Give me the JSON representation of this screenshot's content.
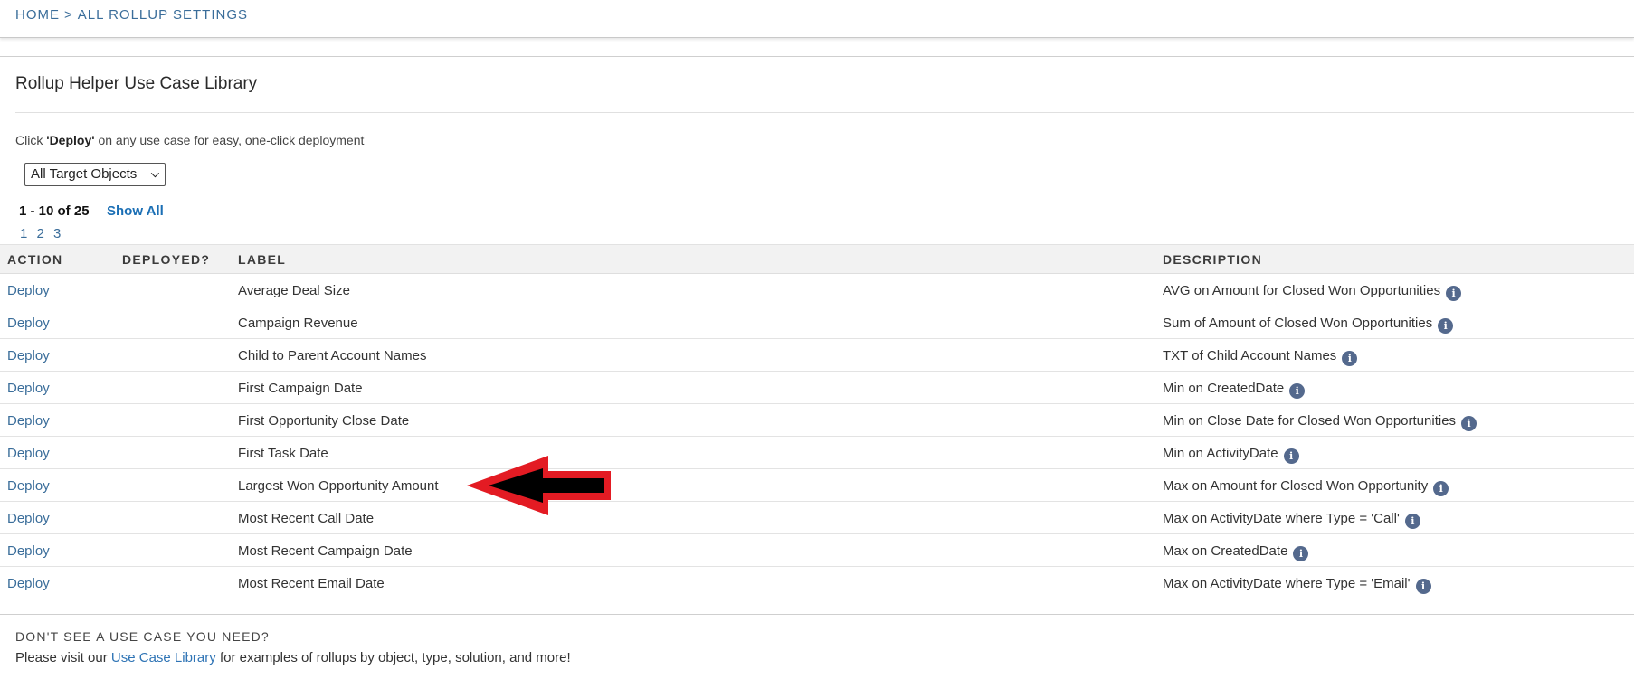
{
  "breadcrumb": {
    "home": "HOME",
    "separator": ">",
    "current": "ALL ROLLUP SETTINGS"
  },
  "title": "Rollup Helper Use Case Library",
  "intro": {
    "prefix": "Click ",
    "bold": "'Deploy'",
    "suffix": " on any use case for easy, one-click deployment"
  },
  "filter": {
    "selected": "All Target Objects"
  },
  "pagination": {
    "count": "1 - 10 of 25",
    "show_all": "Show All",
    "pages": [
      "1",
      "2",
      "3"
    ]
  },
  "table": {
    "headers": {
      "action": "ACTION",
      "deployed": "DEPLOYED?",
      "label": "LABEL",
      "description": "DESCRIPTION"
    },
    "rows": [
      {
        "action": "Deploy",
        "deployed": "",
        "label": "Average Deal Size",
        "description": "AVG on Amount for Closed Won Opportunities"
      },
      {
        "action": "Deploy",
        "deployed": "",
        "label": "Campaign Revenue",
        "description": "Sum of Amount of Closed Won Opportunities"
      },
      {
        "action": "Deploy",
        "deployed": "",
        "label": "Child to Parent Account Names",
        "description": "TXT of Child Account Names"
      },
      {
        "action": "Deploy",
        "deployed": "",
        "label": "First Campaign Date",
        "description": "Min on CreatedDate"
      },
      {
        "action": "Deploy",
        "deployed": "",
        "label": "First Opportunity Close Date",
        "description": "Min on Close Date for Closed Won Opportunities"
      },
      {
        "action": "Deploy",
        "deployed": "",
        "label": "First Task Date",
        "description": "Min on ActivityDate"
      },
      {
        "action": "Deploy",
        "deployed": "",
        "label": "Largest Won Opportunity Amount",
        "description": "Max on Amount for Closed Won Opportunity"
      },
      {
        "action": "Deploy",
        "deployed": "",
        "label": "Most Recent Call Date",
        "description": "Max on ActivityDate where Type = 'Call'"
      },
      {
        "action": "Deploy",
        "deployed": "",
        "label": "Most Recent Campaign Date",
        "description": "Max on CreatedDate"
      },
      {
        "action": "Deploy",
        "deployed": "",
        "label": "Most Recent Email Date",
        "description": "Max on ActivityDate where Type = 'Email'"
      }
    ],
    "info_icon": "i"
  },
  "footer": {
    "heading": "DON'T SEE A USE CASE YOU NEED?",
    "prefix": "Please visit our ",
    "link": "Use Case Library",
    "suffix": " for examples of rollups by object, type, solution, and more!"
  },
  "annotation": {
    "type": "arrow-left",
    "points_to_row": 6,
    "fill": "#000000",
    "outline": "#e31b23"
  }
}
